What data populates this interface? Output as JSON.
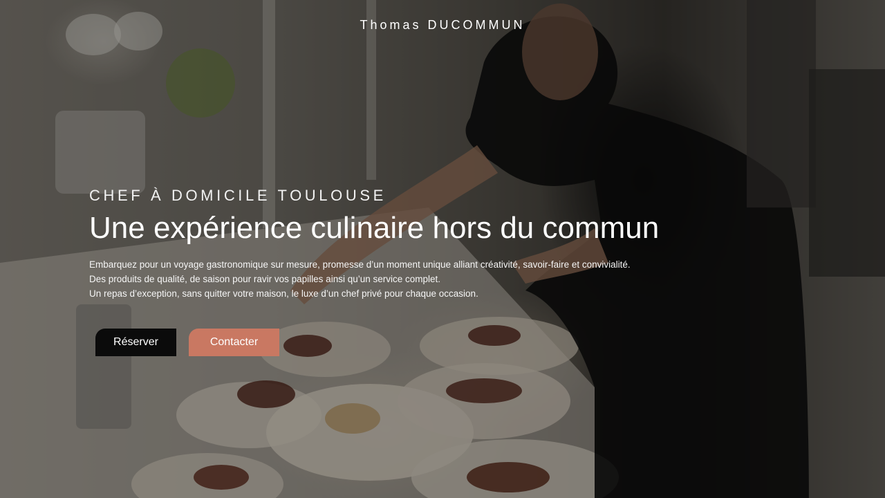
{
  "header": {
    "brand": "Thomas DUCOMMUN"
  },
  "hero": {
    "eyebrow": "CHEF À DOMICILE TOULOUSE",
    "title": "Une expérience culinaire hors du commun",
    "description_lines": [
      "Embarquez pour un voyage gastronomique sur mesure, promesse d’un moment unique alliant créativité, savoir-faire et convivialité.",
      "Des produits de qualité, de saison pour ravir vos papilles ainsi qu’un service complet.",
      "Un repas d’exception, sans quitter votre maison, le luxe d’un chef privé pour chaque occasion."
    ],
    "background_image": "chef-plating-dishes-photo",
    "buttons": {
      "reserve": "Réserver",
      "contact": "Contacter"
    }
  },
  "colors": {
    "reserve_button": "#0b0b0b",
    "contact_button": "#c97862",
    "text": "#ffffff"
  }
}
